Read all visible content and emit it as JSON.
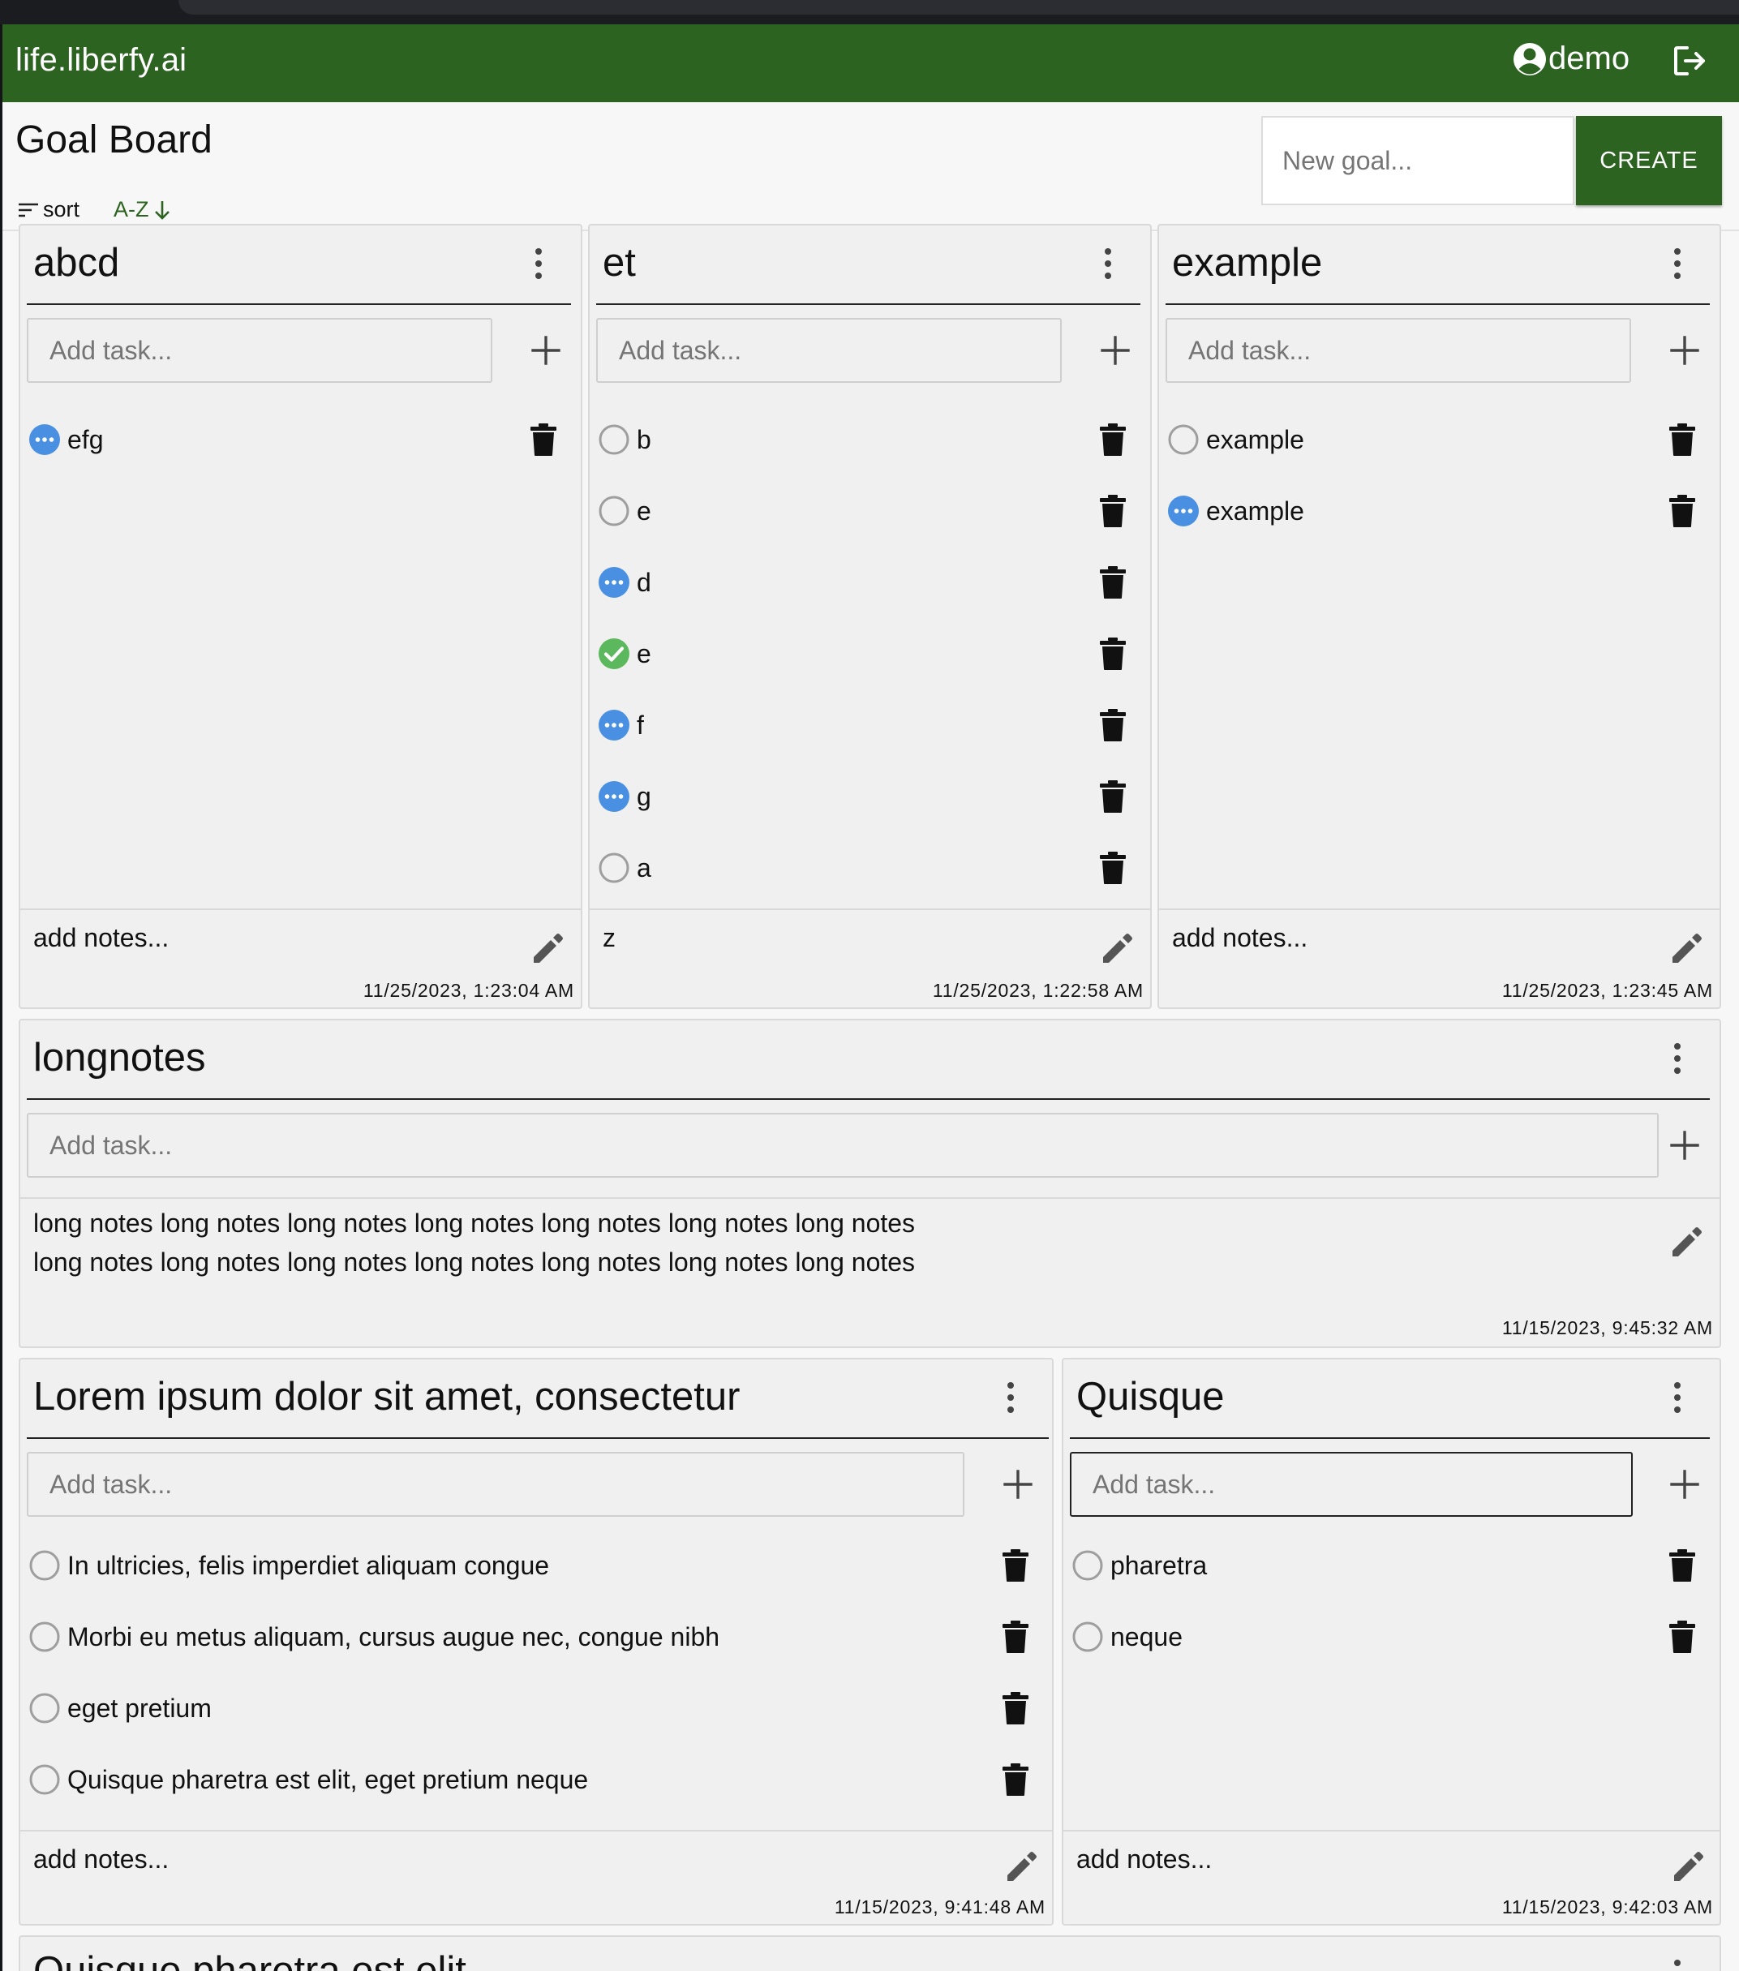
{
  "app": {
    "brand": "life.liberfy.ai",
    "username": "demo"
  },
  "board": {
    "title": "Goal Board",
    "sort_label": "sort",
    "sort_value": "A-Z",
    "new_goal_placeholder": "New goal...",
    "create_label": "CREATE"
  },
  "task_placeholder": "Add task...",
  "status_colors": {
    "in_progress": "#4a90e2",
    "done": "#5cb85c",
    "todo": "#9e9e9e"
  },
  "goals": [
    {
      "title": "abcd",
      "tasks": [
        {
          "label": "efg",
          "status": "in-progress"
        }
      ],
      "notes": "add notes...",
      "timestamp": "11/25/2023, 1:23:04 AM"
    },
    {
      "title": "et",
      "tasks": [
        {
          "label": "b",
          "status": "todo"
        },
        {
          "label": "e",
          "status": "todo"
        },
        {
          "label": "d",
          "status": "in-progress"
        },
        {
          "label": "e",
          "status": "done"
        },
        {
          "label": "f",
          "status": "in-progress"
        },
        {
          "label": "g",
          "status": "in-progress"
        },
        {
          "label": "a",
          "status": "todo"
        }
      ],
      "notes": "z",
      "timestamp": "11/25/2023, 1:22:58 AM"
    },
    {
      "title": "example",
      "tasks": [
        {
          "label": "example",
          "status": "todo"
        },
        {
          "label": "example",
          "status": "in-progress"
        }
      ],
      "notes": "add notes...",
      "timestamp": "11/25/2023, 1:23:45 AM"
    },
    {
      "title": "longnotes",
      "tasks": [],
      "notes_lines": [
        "long notes long notes long notes long notes long notes long notes long notes",
        "long notes long notes long notes long notes long notes long notes long notes"
      ],
      "timestamp": "11/15/2023, 9:45:32 AM"
    },
    {
      "title": "Lorem ipsum dolor sit amet, consectetur",
      "tasks": [
        {
          "label": "In ultricies, felis imperdiet aliquam congue",
          "status": "todo"
        },
        {
          "label": "Morbi eu metus aliquam, cursus augue nec, congue nibh",
          "status": "todo"
        },
        {
          "label": "eget pretium",
          "status": "todo"
        },
        {
          "label": "Quisque pharetra est elit, eget pretium neque",
          "status": "todo"
        }
      ],
      "notes": "add notes...",
      "timestamp": "11/15/2023, 9:41:48 AM"
    },
    {
      "title": "Quisque",
      "tasks": [
        {
          "label": "pharetra",
          "status": "todo"
        },
        {
          "label": "neque",
          "status": "todo"
        }
      ],
      "notes": "add notes...",
      "timestamp": "11/15/2023, 9:42:03 AM"
    },
    {
      "title": "Quisque pharetra est elit,"
    }
  ]
}
